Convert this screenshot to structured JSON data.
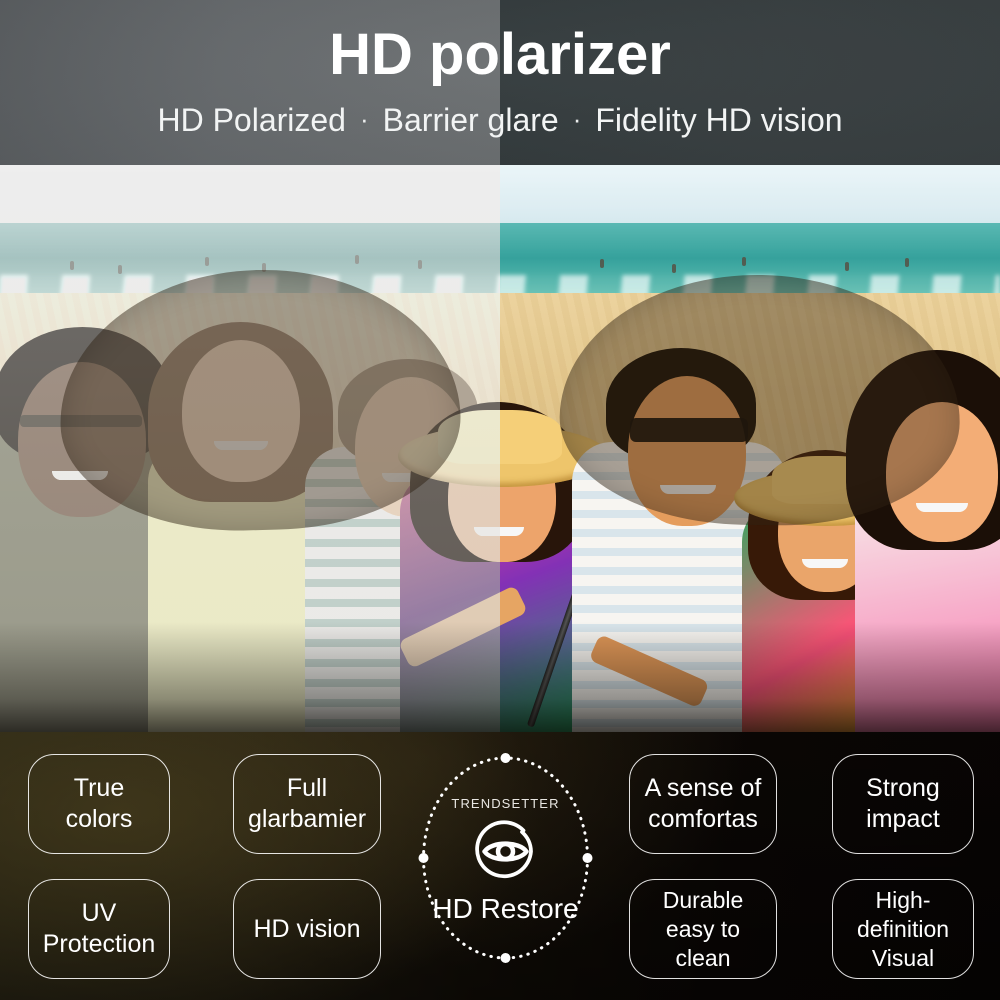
{
  "header": {
    "title": "HD polarizer",
    "tagline_parts": [
      "HD Polarized",
      "Barrier glare",
      "Fidelity HD vision"
    ],
    "separator": "·",
    "bg_left": "#63676a",
    "bg_right": "#343b3d",
    "text_color": "#ffffff"
  },
  "photo": {
    "left_caption": "unpolarized-washed-out-beach-selfie",
    "right_caption": "polarized-saturated-beach-selfie",
    "lens_overlay_color": "#3c2c18"
  },
  "badge": {
    "label": "TRENDSETTER",
    "title": "HD Restore",
    "icon": "eye-in-circle-icon",
    "ring_style": "dotted-circle",
    "ring_marker_count": 4,
    "color": "#ffffff"
  },
  "features": {
    "bg_left": "#2c2817",
    "bg_right": "#080504",
    "border_color": "#ffffff",
    "left_column": [
      {
        "name": "true-colors",
        "text": "True\ncolors"
      },
      {
        "name": "uv-protection",
        "text": "UV\nProtection"
      }
    ],
    "left_column_2": [
      {
        "name": "full-glarbamier",
        "text": "Full\nglarbamier"
      },
      {
        "name": "hd-vision",
        "text": "HD vision"
      }
    ],
    "right_column_1": [
      {
        "name": "sense-of-comfort",
        "text": "A sense of\ncomfortas"
      },
      {
        "name": "durable-easy-clean",
        "text": "Durable\neasy to clean"
      }
    ],
    "right_column_2": [
      {
        "name": "strong-impact",
        "text": "Strong\nimpact"
      },
      {
        "name": "high-definition-visual",
        "text": "High-definition\nVisual"
      }
    ]
  }
}
